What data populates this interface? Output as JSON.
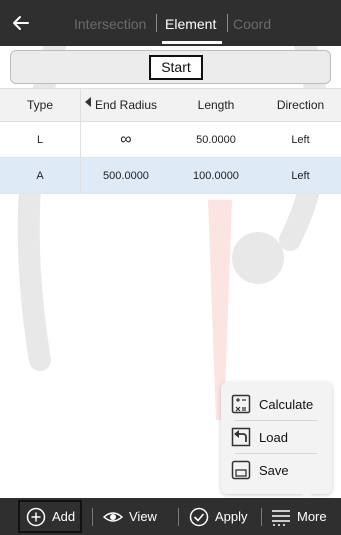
{
  "header": {
    "back_icon": "arrow-left-icon",
    "tabs": [
      {
        "label": "Intersection",
        "active": false
      },
      {
        "label": "Element",
        "active": true
      },
      {
        "label": "Coord",
        "active": false
      }
    ]
  },
  "start_button": {
    "label": "Start"
  },
  "table": {
    "columns": [
      "Type",
      "End Radius",
      "Length",
      "Direction"
    ],
    "rows": [
      {
        "type": "L",
        "end_radius": "∞",
        "length": "50.0000",
        "direction": "Left",
        "selected": false
      },
      {
        "type": "A",
        "end_radius": "500.0000",
        "length": "100.0000",
        "direction": "Left",
        "selected": true
      }
    ]
  },
  "popup_menu": {
    "items": [
      {
        "label": "Calculate",
        "icon": "calculator-icon"
      },
      {
        "label": "Load",
        "icon": "load-icon"
      },
      {
        "label": "Save",
        "icon": "save-icon"
      }
    ]
  },
  "bottom_bar": {
    "add_label": "Add",
    "view_label": "View",
    "apply_label": "Apply",
    "more_label": "More"
  },
  "colors": {
    "bar_background": "#2f2f2f",
    "selected_row": "#deebf7",
    "watermark": "#e32119"
  }
}
